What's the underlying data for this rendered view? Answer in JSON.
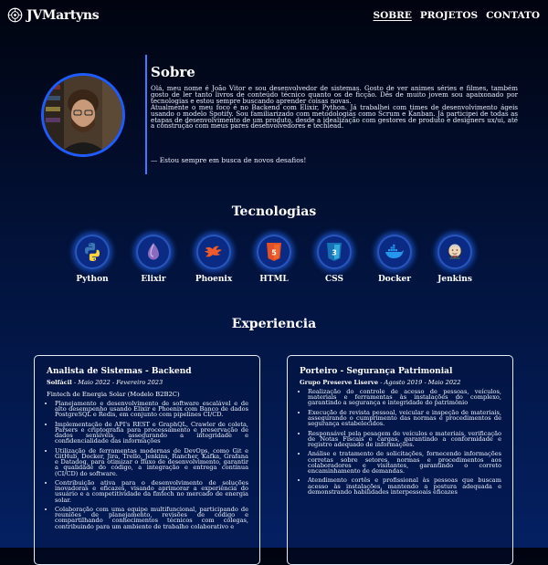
{
  "header": {
    "logo_text": "JVMartyns",
    "nav": [
      {
        "label": "SOBRE",
        "active": true
      },
      {
        "label": "PROJETOS",
        "active": false
      },
      {
        "label": "CONTATO",
        "active": false
      }
    ]
  },
  "about": {
    "title": "Sobre",
    "paragraphs": [
      "Olá, meu nome é João Vitor e sou desenvolvedor de sistemas. Gosto de ver animes séries e filmes, também gosto de ler tanto livros de conteúdo técnico quanto os de ficção. Dês de muito jovem sou apaixonado por tecnologias e estou sempre buscando aprender coisas novas.",
      "Atualmente o meu foco é no Backend com Elixir, Python. Já trabalhei com times de desenvolvimento ágeis usando o modelo Spotify. Sou familiarizado com metodologias como Scrum e Kanban. Já participei de todas as etapas de desenvolvimento de um produto, desde a idealização com gestores de produto e designers ux/ui, até a construção com meus pares desenvolvedores e techlead."
    ],
    "quote": "— Estou sempre em busca de novos desafios!"
  },
  "tech": {
    "title": "Tecnologias",
    "items": [
      {
        "label": "Python",
        "icon": "python-icon"
      },
      {
        "label": "Elixir",
        "icon": "elixir-icon"
      },
      {
        "label": "Phoenix",
        "icon": "phoenix-icon"
      },
      {
        "label": "HTML",
        "icon": "html5-icon"
      },
      {
        "label": "CSS",
        "icon": "css3-icon"
      },
      {
        "label": "Docker",
        "icon": "docker-icon"
      },
      {
        "label": "Jenkins",
        "icon": "jenkins-icon"
      }
    ],
    "colors": {
      "accent": "#1e5cff",
      "circle": "#0a2a83"
    }
  },
  "experience": {
    "title": "Experiencia",
    "jobs": [
      {
        "title": "Analista de Sistemas - Backend",
        "company": "Solfácil",
        "period": "Maio 2022 - Fevereiro 2023",
        "extra": "Fintech de Energia Solar (Modelo B2B2C)",
        "bullets": [
          "Planejamento e desenvolvimento de software escalável e de alto desempenho usando Elixir e Phoenix com Banco de dados PostgreSQL e Redis, em conjunto com pipelines CI/CD.",
          "Implementação de API's REST e GraphQL, Crawler de coleta, Parsers e criptografia para processamento e preservação de dados sensíveis, assegurando a integridade e confidencialidade das informações",
          "Utilização de ferramentas modernas de DevOps, como Git e GitHub, Docker, Jira, Trello, Jenkins, Rancher, Kafka, Grafana e Datadog, para otimizar o fluxo de desenvolvimento, garantir a qualidade do código, a integração e entrega contínua (CI/CD) do software.",
          "Contribuição ativa para o desenvolvimento de soluções inovadoras e eficazes, visando aprimorar a experiência do usuário e a competitividade da fintech no mercado de energia solar.",
          "Colaboração com uma equipe multifuncional, participando de reuniões de planejamento, revisões de código e compartilhando conhecimentos técnicos com colegas, contribuindo para um ambiente de trabalho colaborativo e"
        ]
      },
      {
        "title": "Porteiro - Segurança Patrimonial",
        "company": "Grupo Preserve Liserve",
        "period": "Agosto 2019 - Maio 2022",
        "extra": "",
        "bullets": [
          "Realização do controle de acesso de pessoas, veículos, materiais e ferramentas às instalações do complexo, garantindo a segurança e integridade do patrimônio",
          "Execução de revista pessoal, veicular e inspeção de materiais, assegurando o cumprimento das normas e procedimentos de segurança estabelecidos.",
          "Responsável pela pesagem de veículos e materiais, verificação de Notas Fiscais e cargas, garantindo a conformidade e registro adequado de informações.",
          "Análise e tratamento de solicitações, fornecendo informações corretas sobre setores, normas e procedimentos aos colaboradores e visitantes, garantindo o correto encaminhamento de demandas.",
          "Atendimento cortês e profissional às pessoas que buscam acesso às instalações, mantendo a postura adequada e demonstrando habilidades interpessoais eficazes"
        ]
      }
    ]
  }
}
